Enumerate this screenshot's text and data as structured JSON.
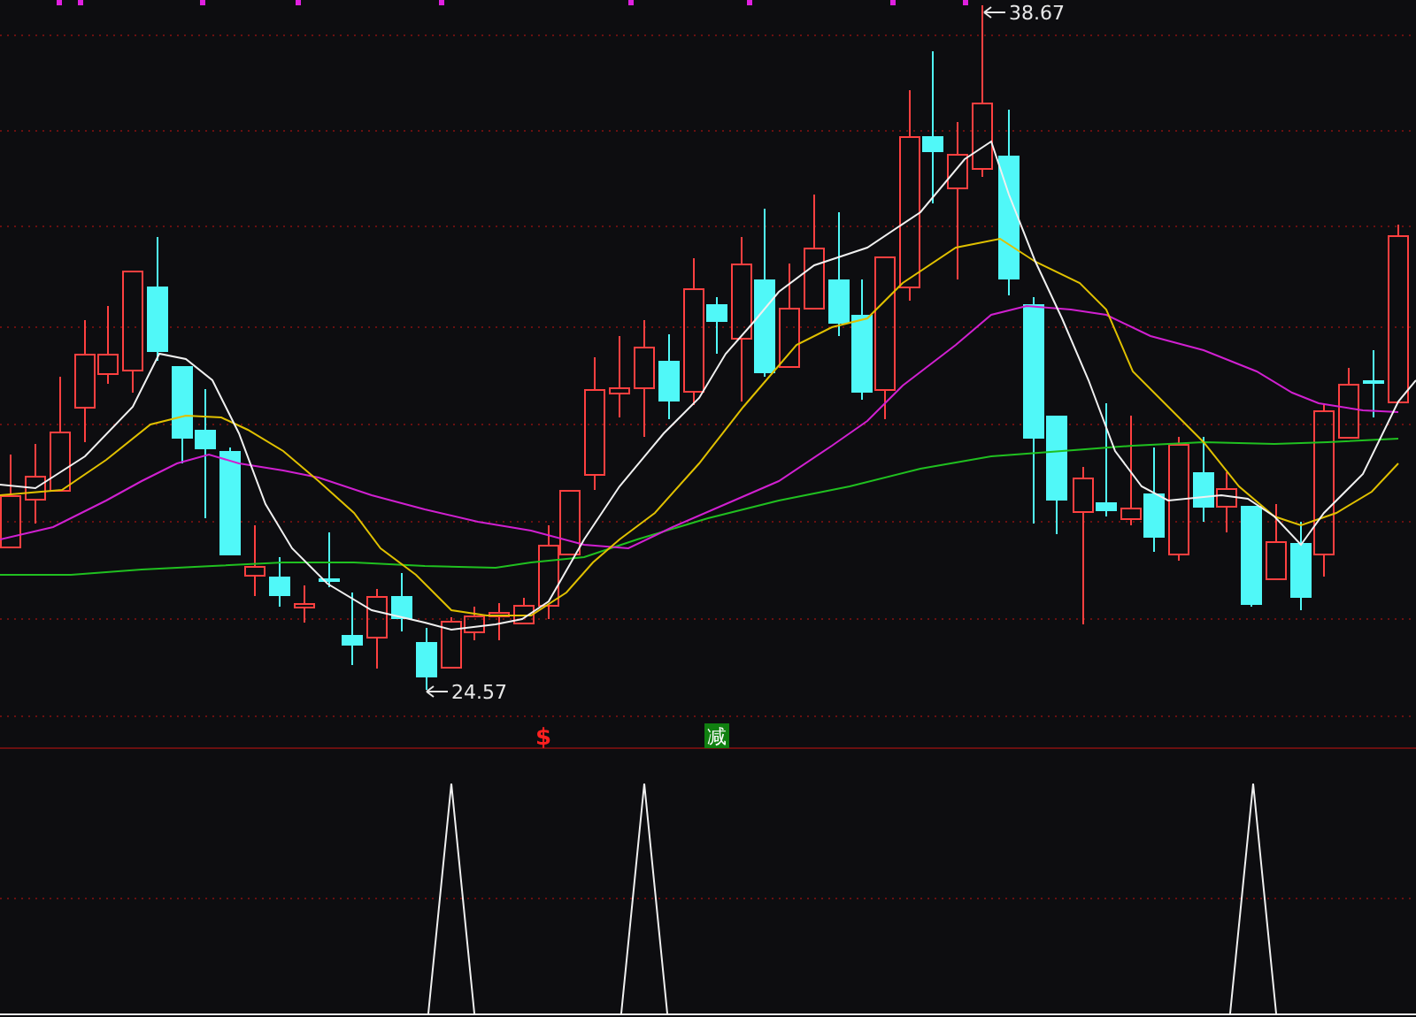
{
  "chart": {
    "high_label": "38.67",
    "low_label": "24.57"
  },
  "signals": [
    {
      "kind": "sell",
      "label": "$"
    },
    {
      "kind": "reduce",
      "label": "减"
    }
  ]
}
